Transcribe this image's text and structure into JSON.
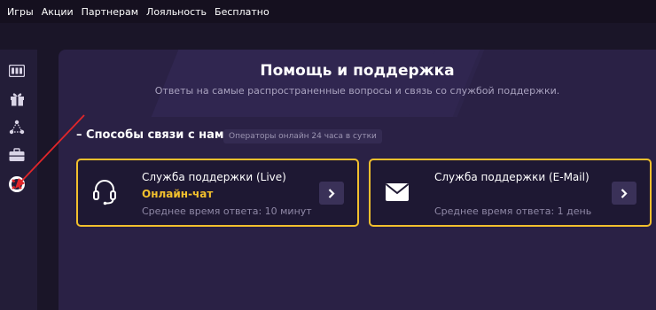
{
  "topnav": {
    "items": [
      "Игры",
      "Акции",
      "Партнерам",
      "Лояльность",
      "Бесплатно"
    ]
  },
  "sidebar": {
    "icons": [
      "slots-icon",
      "gift-icon",
      "network-icon",
      "briefcase-icon",
      "lifebuoy-icon"
    ]
  },
  "header": {
    "title": "Помощь и поддержка",
    "subtitle": "Ответы на самые распространенные вопросы и связь со службой поддержки."
  },
  "section": {
    "title": "– Способы связи с нами",
    "badge": "Операторы онлайн 24 часа в сутки"
  },
  "cards": [
    {
      "title": "Служба поддержки (Live)",
      "subtitle": "Онлайн-чат",
      "time": "Среднее время ответа: 10 минут",
      "icon": "headset-icon"
    },
    {
      "title": "Служба поддержки (E-Mail)",
      "time": "Среднее время ответа: 1 день",
      "icon": "envelope-icon"
    }
  ],
  "colors": {
    "accent": "#f2c02d",
    "background": "#1a1528",
    "panel": "#2a2145",
    "annotation_arrow": "#e0262a"
  }
}
